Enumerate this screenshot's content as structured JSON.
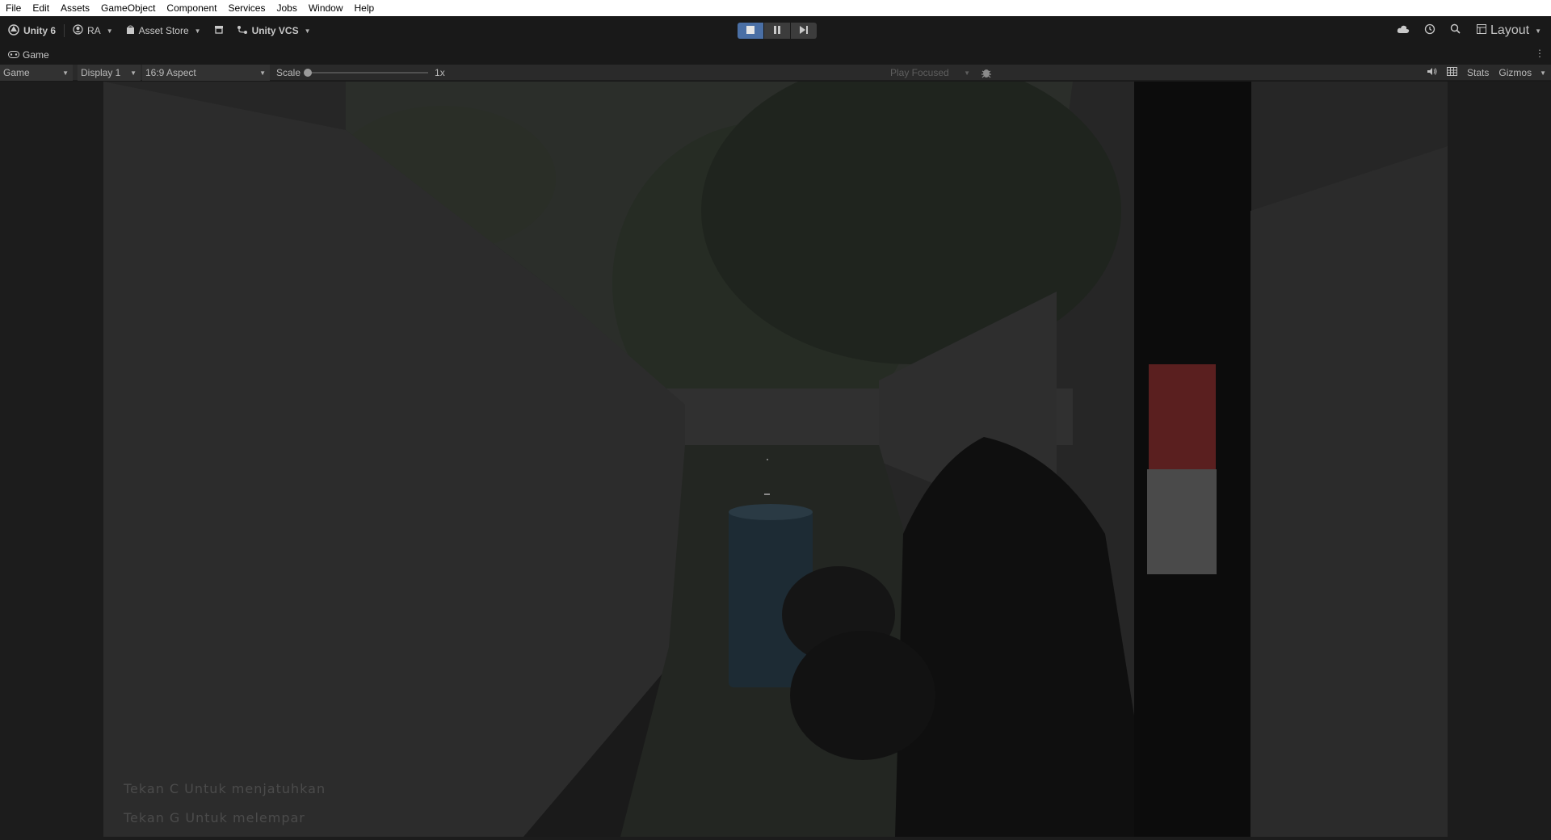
{
  "menu": [
    "File",
    "Edit",
    "Assets",
    "GameObject",
    "Component",
    "Services",
    "Jobs",
    "Window",
    "Help"
  ],
  "toolbar": {
    "unity_label": "Unity 6",
    "account_label": "RA",
    "asset_store_label": "Asset Store",
    "vcs_label": "Unity VCS",
    "layout_label": "Layout"
  },
  "tab": {
    "game_label": "Game"
  },
  "gamebar": {
    "mode": "Game",
    "display": "Display 1",
    "aspect": "16:9 Aspect",
    "scale_label": "Scale",
    "scale_value": "1x",
    "play_focused": "Play Focused",
    "stats_label": "Stats",
    "gizmos_label": "Gizmos"
  },
  "game": {
    "hint_drop": "Tekan C Untuk menjatuhkan",
    "hint_throw": "Tekan G Untuk melempar"
  },
  "colors": {
    "play_active": "#4a6fa5",
    "menubar": "#ffffff",
    "toolbar": "#191919"
  }
}
